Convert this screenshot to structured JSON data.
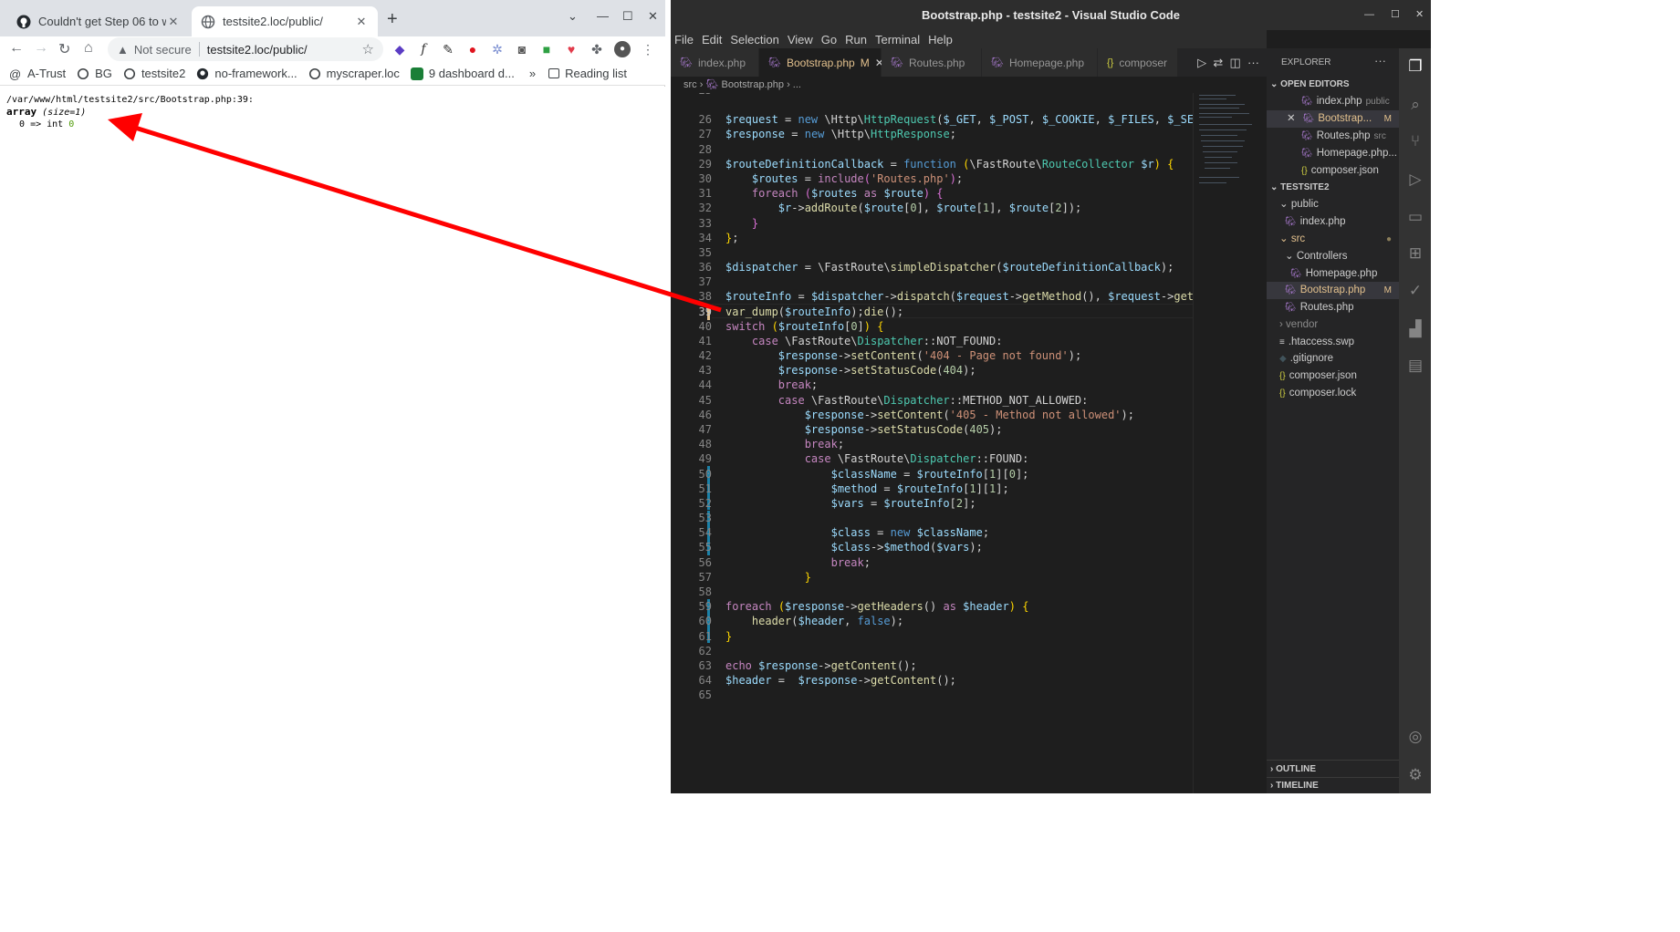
{
  "browser": {
    "tabs": [
      {
        "title": "Couldn't get Step 06 to wo",
        "close": "✕"
      },
      {
        "title": "testsite2.loc/public/",
        "close": "✕"
      }
    ],
    "new_tab": "+",
    "security": "Not secure",
    "url": "testsite2.loc/public/",
    "bookmarks": [
      "A-Trust",
      "BG",
      "testsite2",
      "no-framework...",
      "myscraper.loc",
      "9 dashboard d..."
    ],
    "bookmarks_more": "»",
    "reading_list": "Reading list",
    "output": {
      "path": "/var/www/html/testsite2/src/Bootstrap.php:39:",
      "array_word": "array",
      "size": "(size=1)",
      "row_key": "0",
      "row_op": "=>",
      "row_type": "int",
      "row_val": "0"
    }
  },
  "vscode": {
    "title": "Bootstrap.php - testsite2 - Visual Studio Code",
    "menu": [
      "File",
      "Edit",
      "Selection",
      "View",
      "Go",
      "Run",
      "Terminal",
      "Help"
    ],
    "tabs": [
      {
        "label": "index.php",
        "icon": "php-icon"
      },
      {
        "label": "Bootstrap.php",
        "icon": "php-icon",
        "mod": "M",
        "close": "✕"
      },
      {
        "label": "Routes.php",
        "icon": "php-icon"
      },
      {
        "label": "Homepage.php",
        "icon": "php-icon"
      },
      {
        "label": "composer",
        "icon": "json-icon"
      }
    ],
    "breadcrumb": {
      "folder": "src",
      "file": "Bootstrap.php",
      "more": "..."
    },
    "explorer": {
      "header": "EXPLORER",
      "open_editors": "OPEN EDITORS",
      "open_files": [
        {
          "name": "index.php",
          "hint": "public"
        },
        {
          "name": "Bootstrap...",
          "mod": "M"
        },
        {
          "name": "Routes.php",
          "hint": "src"
        },
        {
          "name": "Homepage.php..."
        },
        {
          "name": "composer.json"
        }
      ],
      "project": "TESTSITE2",
      "tree": [
        "public",
        "index.php",
        "src",
        "Controllers",
        "Homepage.php",
        "Bootstrap.php",
        "Routes.php",
        "vendor",
        ".htaccess.swp",
        ".gitignore",
        "composer.json",
        "composer.lock"
      ],
      "bootstrap_mod": "M",
      "outline": "OUTLINE",
      "timeline": "TIMELINE"
    },
    "accent_color": "#1b81a8",
    "arrow_color": "#ff0000"
  }
}
